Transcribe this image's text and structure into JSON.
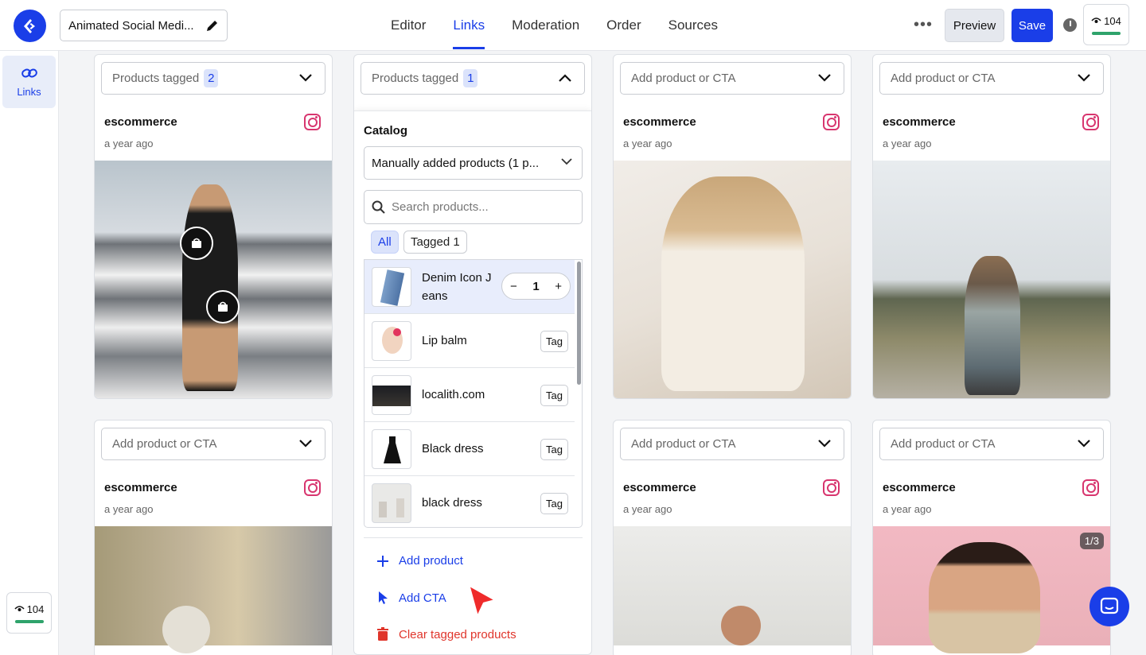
{
  "header": {
    "project_title": "Animated Social Medi...",
    "tabs": [
      {
        "label": "Editor"
      },
      {
        "label": "Links"
      },
      {
        "label": "Moderation"
      },
      {
        "label": "Order"
      },
      {
        "label": "Sources"
      }
    ],
    "more_label": "•••",
    "preview_label": "Preview",
    "save_label": "Save",
    "counter_value": "104"
  },
  "sidebar": {
    "links_label": "Links",
    "counter_value": "104"
  },
  "cards": [
    {
      "selector_label": "Products tagged",
      "selector_count": "2",
      "user": "escommerce",
      "time": "a year ago"
    },
    {
      "selector_label": "Add product or CTA",
      "user": "escommerce",
      "time": "a year ago"
    },
    {
      "selector_label": "Add product or CTA",
      "user": "escommerce",
      "time": "a year ago"
    },
    {
      "selector_label": "Add product or CTA",
      "user": "escommerce",
      "time": "a year ago"
    },
    {
      "selector_label": "Add product or CTA",
      "user": "escommerce",
      "time": "a year ago"
    },
    {
      "selector_label": "Add product or CTA",
      "user": "escommerce",
      "time": "a year ago",
      "slide_counter": "1/3"
    }
  ],
  "panel": {
    "selector_label": "Products tagged",
    "selector_count": "1",
    "catalog_label": "Catalog",
    "catalog_value": "Manually added products (1 p...",
    "search_placeholder": "Search products...",
    "filters": {
      "all": "All",
      "tagged": "Tagged 1"
    },
    "products": [
      {
        "name": "Denim Icon Jeans",
        "quantity": "1"
      },
      {
        "name": "Lip balm",
        "action": "Tag"
      },
      {
        "name": "localith.com",
        "action": "Tag"
      },
      {
        "name": "Black dress",
        "action": "Tag"
      },
      {
        "name": "black dress",
        "action": "Tag"
      }
    ],
    "actions": {
      "add_product": "Add product",
      "add_cta": "Add CTA",
      "clear": "Clear tagged products"
    }
  },
  "colors": {
    "accent": "#1a3ee8",
    "danger": "#e0352b",
    "success": "#2fa36b"
  }
}
